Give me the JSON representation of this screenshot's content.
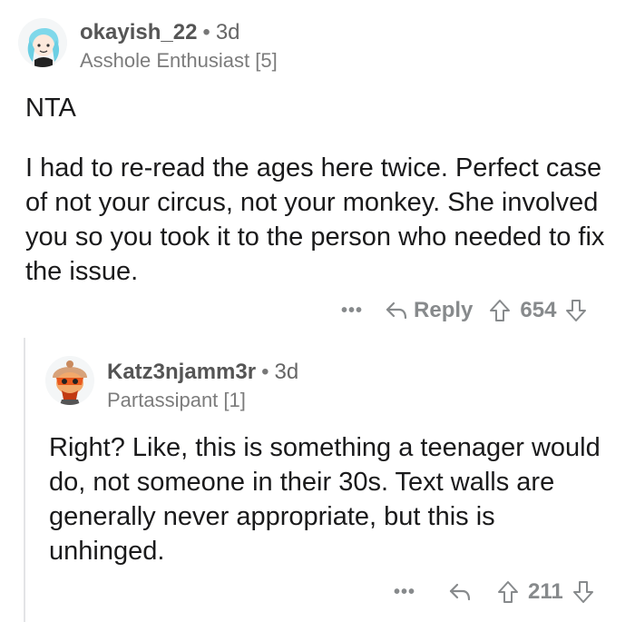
{
  "comment1": {
    "username": "okayish_22",
    "age": "3d",
    "flair": "Asshole Enthusiast [5]",
    "paragraphs": [
      "NTA",
      "I had to re-read the ages here twice. Perfect case of not your circus, not your monkey. She involved you so you took it to the person who needed to fix the issue."
    ],
    "actions": {
      "more": "•••",
      "reply": "Reply",
      "score": "654"
    }
  },
  "comment2": {
    "username": "Katz3njamm3r",
    "age": "3d",
    "flair": "Partassipant [1]",
    "paragraphs": [
      "Right? Like, this is something a teenager would do, not someone in their 30s. Text walls are generally never appropriate, but this is unhinged."
    ],
    "actions": {
      "more": "•••",
      "score": "211"
    }
  },
  "colors": {
    "text": "#1a1a1b",
    "meta": "#7c7c7c",
    "icon": "#878a8c",
    "thread": "#e3e4e6"
  }
}
